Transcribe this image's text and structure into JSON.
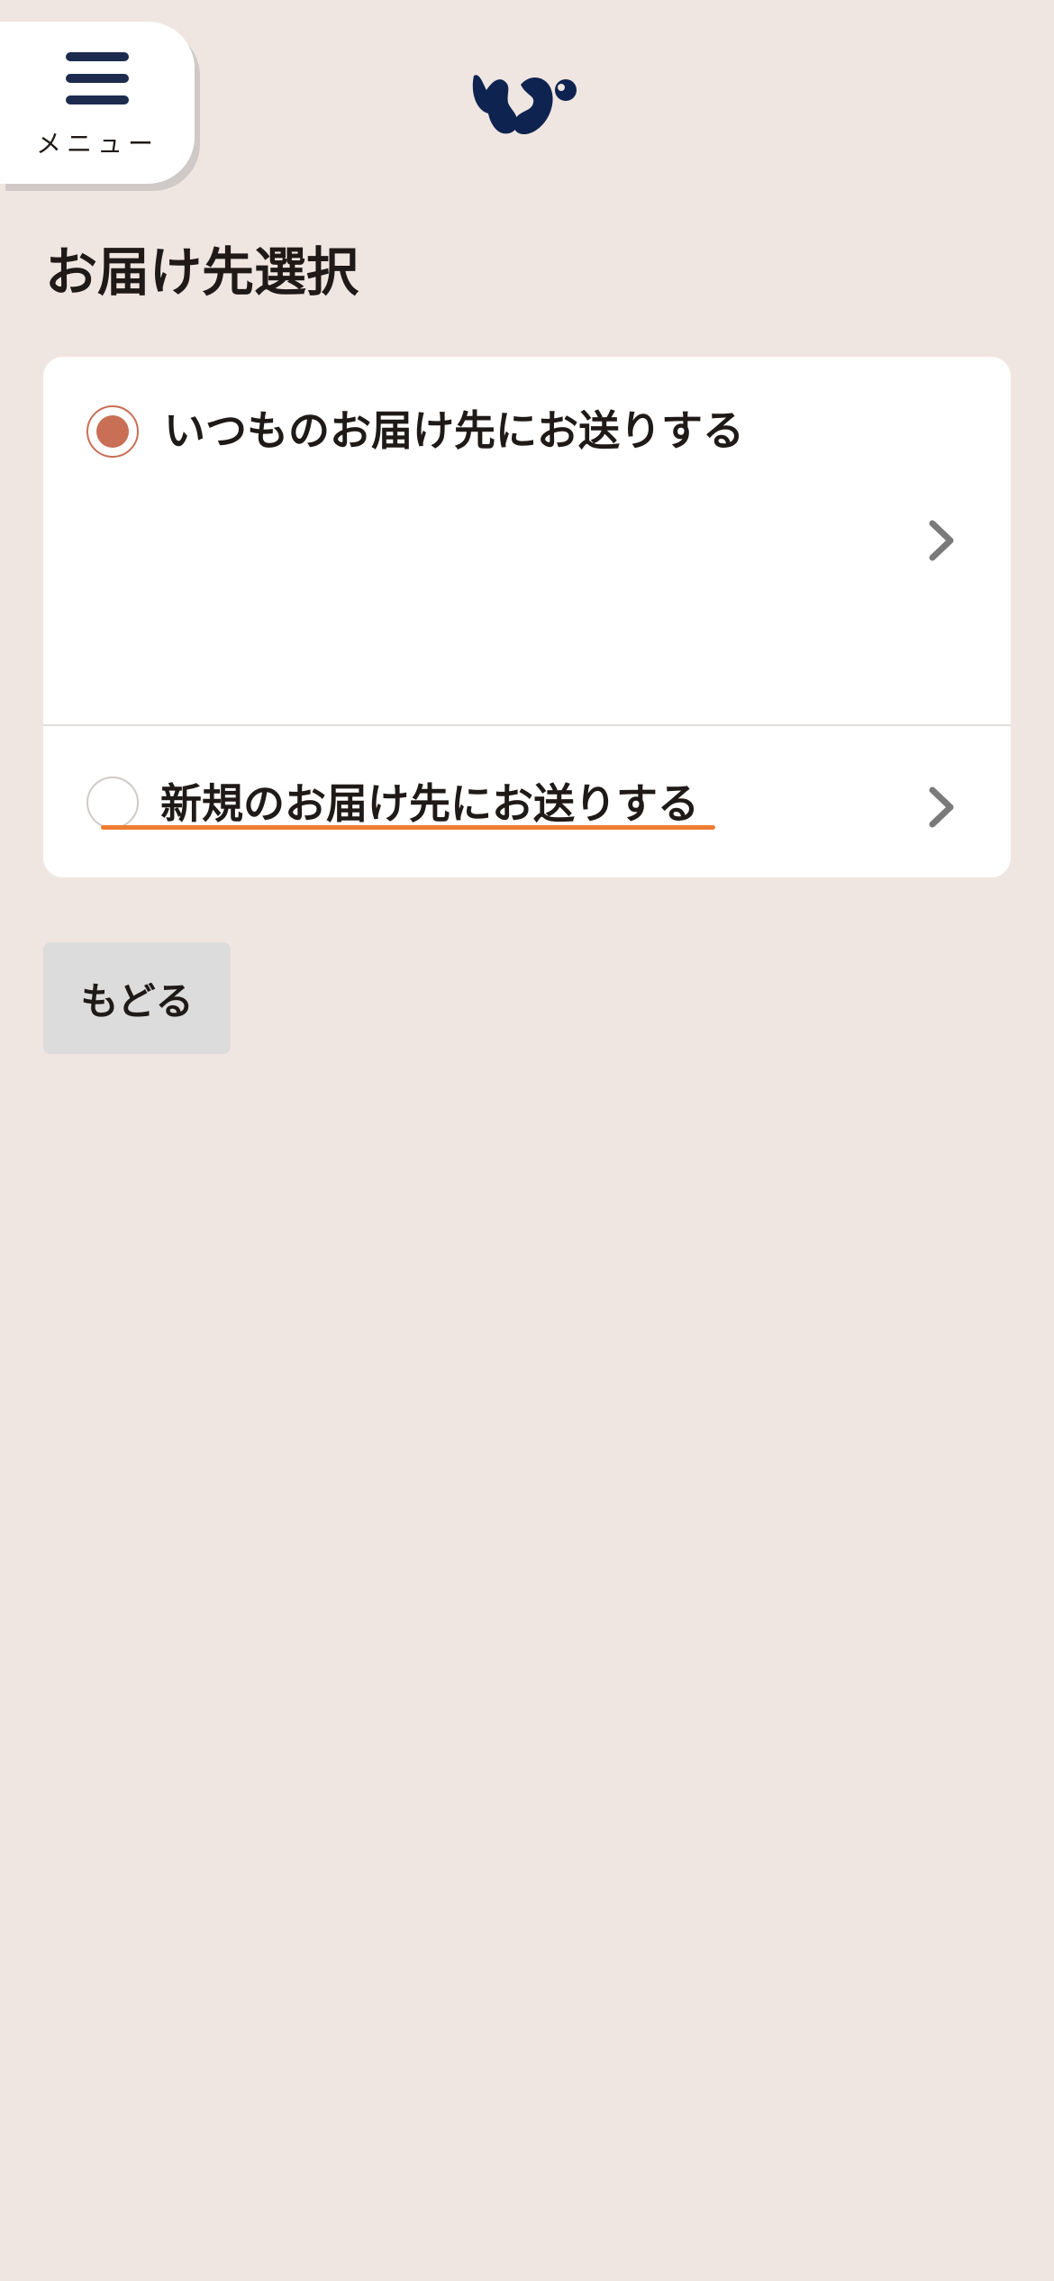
{
  "header": {
    "menu_label": "メニュー",
    "menu_icon": "hamburger-menu-icon",
    "logo_icon": "squirrel-logo-icon",
    "logo_color": "#0f2350"
  },
  "page": {
    "title": "お届け先選択"
  },
  "delivery_options": [
    {
      "label": "いつものお届け先にお送りする",
      "selected": true,
      "icon": "chevron-right-icon"
    },
    {
      "label": "新規のお届け先にお送りする",
      "selected": false,
      "icon": "chevron-right-icon"
    }
  ],
  "actions": {
    "back_label": "もどる"
  },
  "colors": {
    "background": "#f0e6e1",
    "radio_selected": "#c86f55",
    "focus_underline": "#ee7d32",
    "menu_icon": "#1d2b4f",
    "chevron": "#7a7a7a"
  }
}
